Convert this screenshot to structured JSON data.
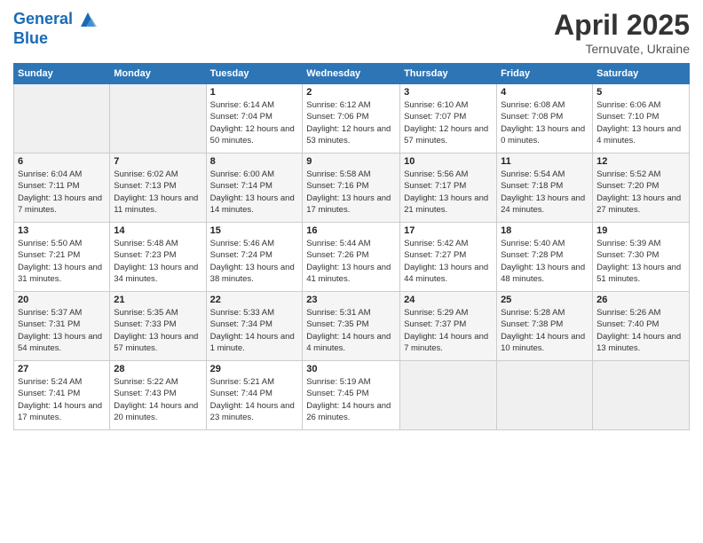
{
  "header": {
    "logo_line1": "General",
    "logo_line2": "Blue",
    "title": "April 2025",
    "location": "Ternuvate, Ukraine"
  },
  "columns": [
    "Sunday",
    "Monday",
    "Tuesday",
    "Wednesday",
    "Thursday",
    "Friday",
    "Saturday"
  ],
  "weeks": [
    [
      {
        "day": "",
        "detail": ""
      },
      {
        "day": "",
        "detail": ""
      },
      {
        "day": "1",
        "detail": "Sunrise: 6:14 AM\nSunset: 7:04 PM\nDaylight: 12 hours\nand 50 minutes."
      },
      {
        "day": "2",
        "detail": "Sunrise: 6:12 AM\nSunset: 7:06 PM\nDaylight: 12 hours\nand 53 minutes."
      },
      {
        "day": "3",
        "detail": "Sunrise: 6:10 AM\nSunset: 7:07 PM\nDaylight: 12 hours\nand 57 minutes."
      },
      {
        "day": "4",
        "detail": "Sunrise: 6:08 AM\nSunset: 7:08 PM\nDaylight: 13 hours\nand 0 minutes."
      },
      {
        "day": "5",
        "detail": "Sunrise: 6:06 AM\nSunset: 7:10 PM\nDaylight: 13 hours\nand 4 minutes."
      }
    ],
    [
      {
        "day": "6",
        "detail": "Sunrise: 6:04 AM\nSunset: 7:11 PM\nDaylight: 13 hours\nand 7 minutes."
      },
      {
        "day": "7",
        "detail": "Sunrise: 6:02 AM\nSunset: 7:13 PM\nDaylight: 13 hours\nand 11 minutes."
      },
      {
        "day": "8",
        "detail": "Sunrise: 6:00 AM\nSunset: 7:14 PM\nDaylight: 13 hours\nand 14 minutes."
      },
      {
        "day": "9",
        "detail": "Sunrise: 5:58 AM\nSunset: 7:16 PM\nDaylight: 13 hours\nand 17 minutes."
      },
      {
        "day": "10",
        "detail": "Sunrise: 5:56 AM\nSunset: 7:17 PM\nDaylight: 13 hours\nand 21 minutes."
      },
      {
        "day": "11",
        "detail": "Sunrise: 5:54 AM\nSunset: 7:18 PM\nDaylight: 13 hours\nand 24 minutes."
      },
      {
        "day": "12",
        "detail": "Sunrise: 5:52 AM\nSunset: 7:20 PM\nDaylight: 13 hours\nand 27 minutes."
      }
    ],
    [
      {
        "day": "13",
        "detail": "Sunrise: 5:50 AM\nSunset: 7:21 PM\nDaylight: 13 hours\nand 31 minutes."
      },
      {
        "day": "14",
        "detail": "Sunrise: 5:48 AM\nSunset: 7:23 PM\nDaylight: 13 hours\nand 34 minutes."
      },
      {
        "day": "15",
        "detail": "Sunrise: 5:46 AM\nSunset: 7:24 PM\nDaylight: 13 hours\nand 38 minutes."
      },
      {
        "day": "16",
        "detail": "Sunrise: 5:44 AM\nSunset: 7:26 PM\nDaylight: 13 hours\nand 41 minutes."
      },
      {
        "day": "17",
        "detail": "Sunrise: 5:42 AM\nSunset: 7:27 PM\nDaylight: 13 hours\nand 44 minutes."
      },
      {
        "day": "18",
        "detail": "Sunrise: 5:40 AM\nSunset: 7:28 PM\nDaylight: 13 hours\nand 48 minutes."
      },
      {
        "day": "19",
        "detail": "Sunrise: 5:39 AM\nSunset: 7:30 PM\nDaylight: 13 hours\nand 51 minutes."
      }
    ],
    [
      {
        "day": "20",
        "detail": "Sunrise: 5:37 AM\nSunset: 7:31 PM\nDaylight: 13 hours\nand 54 minutes."
      },
      {
        "day": "21",
        "detail": "Sunrise: 5:35 AM\nSunset: 7:33 PM\nDaylight: 13 hours\nand 57 minutes."
      },
      {
        "day": "22",
        "detail": "Sunrise: 5:33 AM\nSunset: 7:34 PM\nDaylight: 14 hours\nand 1 minute."
      },
      {
        "day": "23",
        "detail": "Sunrise: 5:31 AM\nSunset: 7:35 PM\nDaylight: 14 hours\nand 4 minutes."
      },
      {
        "day": "24",
        "detail": "Sunrise: 5:29 AM\nSunset: 7:37 PM\nDaylight: 14 hours\nand 7 minutes."
      },
      {
        "day": "25",
        "detail": "Sunrise: 5:28 AM\nSunset: 7:38 PM\nDaylight: 14 hours\nand 10 minutes."
      },
      {
        "day": "26",
        "detail": "Sunrise: 5:26 AM\nSunset: 7:40 PM\nDaylight: 14 hours\nand 13 minutes."
      }
    ],
    [
      {
        "day": "27",
        "detail": "Sunrise: 5:24 AM\nSunset: 7:41 PM\nDaylight: 14 hours\nand 17 minutes."
      },
      {
        "day": "28",
        "detail": "Sunrise: 5:22 AM\nSunset: 7:43 PM\nDaylight: 14 hours\nand 20 minutes."
      },
      {
        "day": "29",
        "detail": "Sunrise: 5:21 AM\nSunset: 7:44 PM\nDaylight: 14 hours\nand 23 minutes."
      },
      {
        "day": "30",
        "detail": "Sunrise: 5:19 AM\nSunset: 7:45 PM\nDaylight: 14 hours\nand 26 minutes."
      },
      {
        "day": "",
        "detail": ""
      },
      {
        "day": "",
        "detail": ""
      },
      {
        "day": "",
        "detail": ""
      }
    ]
  ]
}
